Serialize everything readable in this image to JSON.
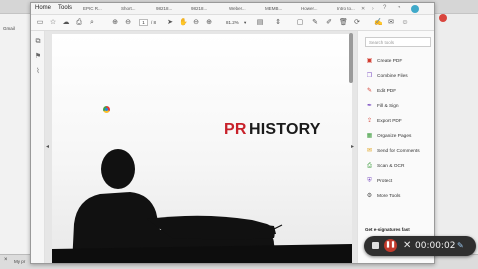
{
  "colors": {
    "accent_red": "#c8212a",
    "title_dark": "#1b1b1b",
    "tool_icon_red": "#d23b2f",
    "tool_icon_purple": "#7a4cc2",
    "recorder_bg": "#2f2f2f"
  },
  "menubar": {
    "items": [
      "Home",
      "Tools"
    ],
    "doc_tabs": [
      "EPIC R...",
      "Short...",
      "98218...",
      "98218...",
      "Weber...",
      "MEMB...",
      "Hower...",
      "Intro to..."
    ]
  },
  "toolbar": {
    "page_current": "1",
    "page_total": "/ 8",
    "zoom": "81.2%"
  },
  "document": {
    "title_red": "PR",
    "title_dark": "HISTORY"
  },
  "tools_pane": {
    "search_placeholder": "Search tools",
    "items": [
      {
        "label": "Create PDF",
        "icon": "create-pdf-icon"
      },
      {
        "label": "Combine Files",
        "icon": "combine-files-icon"
      },
      {
        "label": "Edit PDF",
        "icon": "edit-pdf-icon"
      },
      {
        "label": "Fill & Sign",
        "icon": "fill-sign-icon"
      },
      {
        "label": "Export PDF",
        "icon": "export-pdf-icon"
      },
      {
        "label": "Organize Pages",
        "icon": "organize-pages-icon"
      },
      {
        "label": "Send for Comments",
        "icon": "send-comments-icon"
      },
      {
        "label": "Scan & OCR",
        "icon": "scan-ocr-icon"
      },
      {
        "label": "Protect",
        "icon": "protect-icon"
      },
      {
        "label": "More Tools",
        "icon": "more-tools-icon"
      }
    ],
    "esign_text": "Get e-signatures fast"
  },
  "recorder": {
    "time": "00:00:02"
  },
  "browser": {
    "left_label": "Gmail",
    "bottom_label": "My pr"
  }
}
